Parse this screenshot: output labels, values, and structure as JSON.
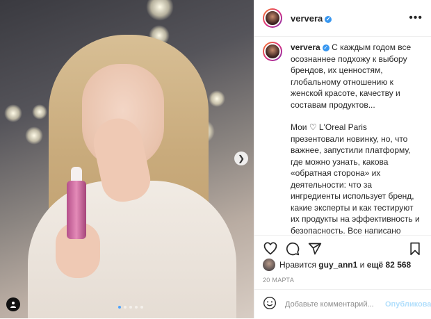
{
  "post": {
    "username": "ververa",
    "verified_icon": "✓",
    "more_icon": "•••"
  },
  "caption": {
    "username": "ververa",
    "paragraph1": "С каждым годом все осознаннее подхожу к выбору брендов, их ценностям, глобальному отношению к женской красоте, качеству и составам продуктов...",
    "paragraph2": "Мои ♡ L'Oreal Paris презентовали новинку, но, что важнее, запустили платформу, где можно узнать, какова «обратная сторона» их деятельности: что за ингредиенты использует бренд, какие эксперты и как тестируют их продукты на эффективность и безопасность. Все написано доступным и понятным языком, даже про уникальную модель реконструированной кожи для исследований. 👏 *сильно"
  },
  "likes": {
    "prefix": "Нравится",
    "user": "guy_ann1",
    "conj": "и",
    "rest": "ещё 82 568"
  },
  "date": "20 МАРТА",
  "comment": {
    "placeholder": "Добавьте комментарий...",
    "publish": "Опубликовать"
  },
  "carousel": {
    "total": 5,
    "active": 1
  },
  "colors": {
    "verified": "#3897f0",
    "publish_disabled": "#b2dffc",
    "dot_active": "#4da3ff"
  }
}
